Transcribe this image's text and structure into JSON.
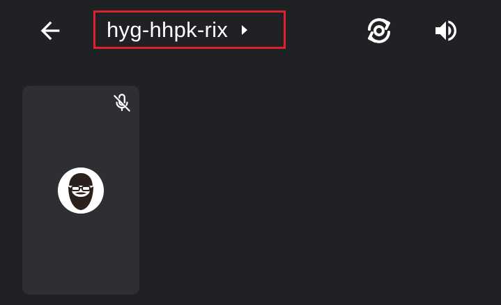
{
  "header": {
    "meeting_code": "hyg-hhpk-rix",
    "icons": {
      "back": "arrow-back-icon",
      "meeting_details": "caret-right-icon",
      "switch_camera": "switch-camera-icon",
      "audio": "volume-up-icon"
    },
    "highlight_color": "#e0202a"
  },
  "participant_tile": {
    "mic_status_icon": "mic-off-icon",
    "avatar_icon": "bearded-man-avatar"
  },
  "colors": {
    "background": "#202124",
    "tile": "#2e2f32",
    "icon": "#ffffff"
  }
}
